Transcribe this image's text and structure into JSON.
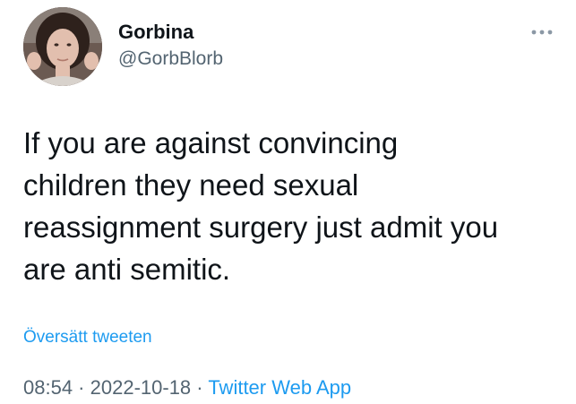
{
  "tweet": {
    "author": {
      "display_name": "Gorbina",
      "handle": "@GorbBlorb"
    },
    "text": "If you are against convincing\nchildren they need sexual\nreassignment surgery just admit you\nare anti semitic.",
    "translate_label": "Översätt tweeten",
    "meta": {
      "time": "08:54",
      "separator": " · ",
      "date": "2022-10-18",
      "source": "Twitter Web App"
    }
  },
  "colors": {
    "text": "#0f1419",
    "secondary": "#536471",
    "link": "#1d9bf0",
    "background": "#ffffff"
  },
  "icons": {
    "more": "more-horizontal-icon",
    "avatar": "avatar"
  }
}
